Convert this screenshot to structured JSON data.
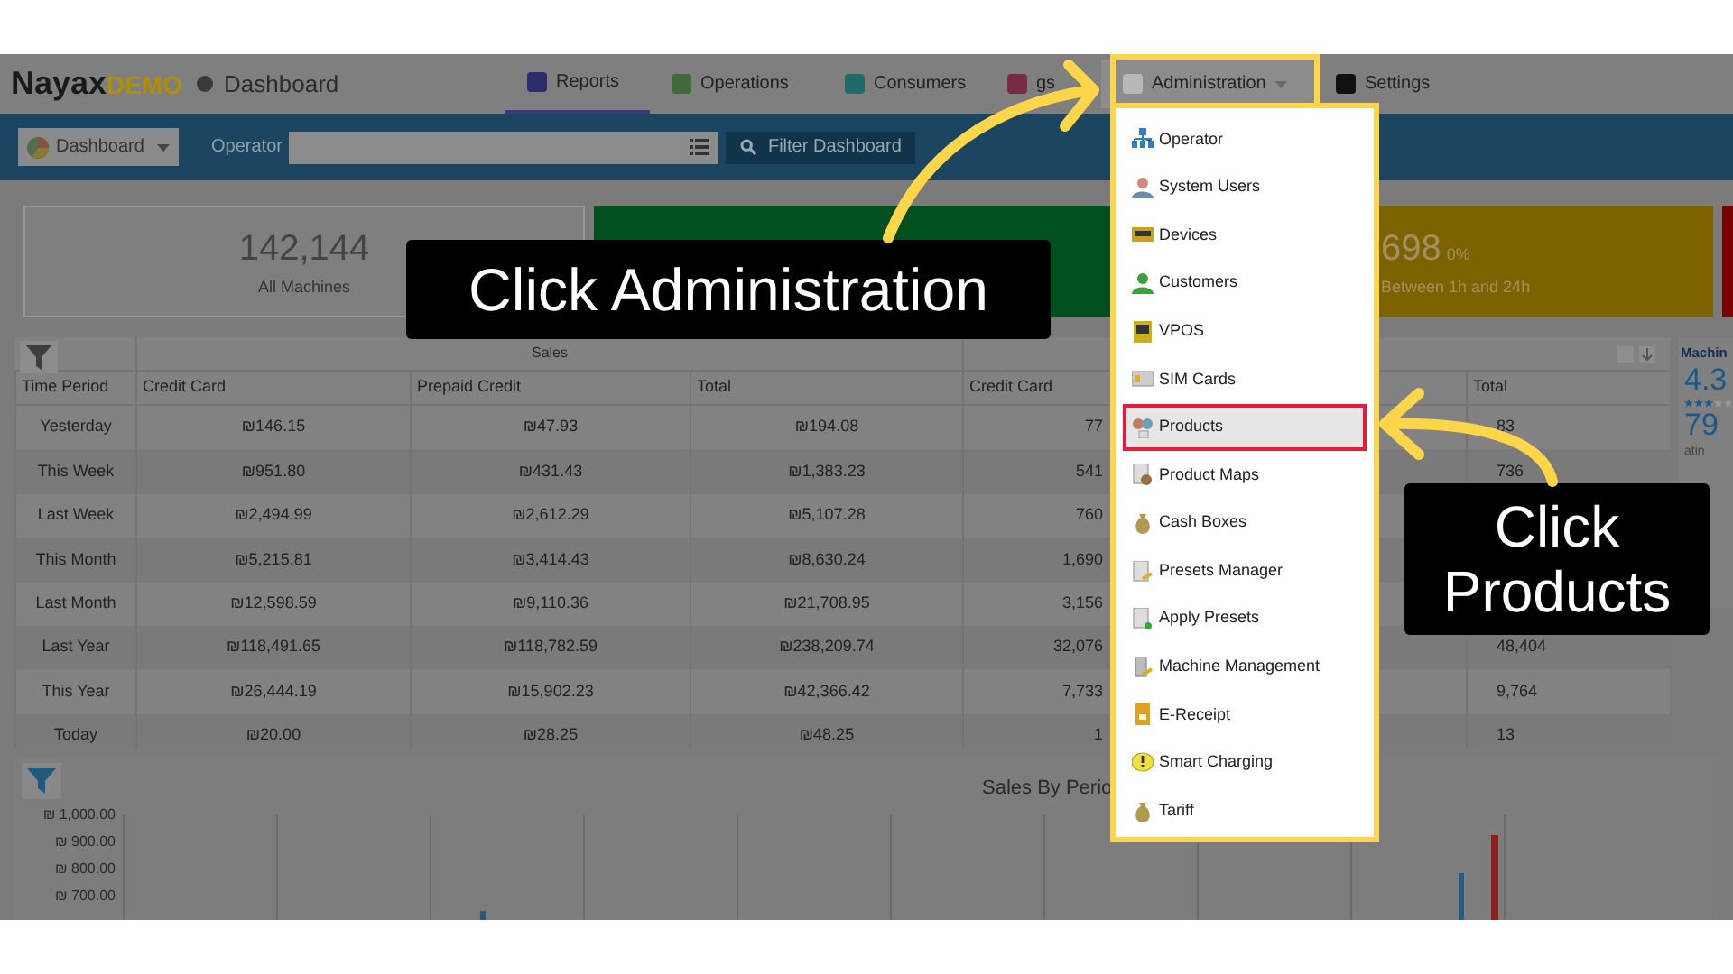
{
  "header": {
    "logo": "Nayax",
    "logo_suffix": "DEMO",
    "page_title": "Dashboard"
  },
  "nav_tabs": [
    {
      "label": "Reports",
      "selected": true
    },
    {
      "label": "Operations",
      "selected": false
    },
    {
      "label": "Consumers",
      "selected": false
    },
    {
      "label": "gs",
      "selected": false
    },
    {
      "label": "Administration",
      "selected": false,
      "expanded": true
    },
    {
      "label": "Settings",
      "selected": false
    }
  ],
  "toolbar": {
    "dashboard_button": "Dashboard",
    "operator_label": "Operator",
    "filter_button": "Filter Dashboard"
  },
  "stat_cards": [
    {
      "value": "142,144",
      "caption": "All Machines",
      "color": "#7f7f7f"
    },
    {
      "color": "#00501f"
    },
    {
      "value": "698",
      "percent": "0%",
      "caption": "Between 1h and 24h",
      "color": "#7d6300"
    },
    {
      "color": "#7a0000"
    }
  ],
  "sales_table": {
    "group_header": "Sales",
    "columns": [
      "Time Period",
      "Credit Card",
      "Prepaid Credit",
      "Total",
      "Credit Card",
      "Total"
    ],
    "rows": [
      {
        "cells": [
          "Yesterday",
          "₪146.15",
          "₪47.93",
          "₪194.08",
          "77",
          "83"
        ]
      },
      {
        "cells": [
          "This Week",
          "₪951.80",
          "₪431.43",
          "₪1,383.23",
          "541",
          "736"
        ]
      },
      {
        "cells": [
          "Last Week",
          "₪2,494.99",
          "₪2,612.29",
          "₪5,107.28",
          "760"
        ]
      },
      {
        "cells": [
          "This Month",
          "₪5,215.81",
          "₪3,414.43",
          "₪8,630.24",
          "1,690"
        ]
      },
      {
        "cells": [
          "Last Month",
          "₪12,598.59",
          "₪9,110.36",
          "₪21,708.95",
          "3,156"
        ]
      },
      {
        "cells": [
          "Last Year",
          "₪118,491.65",
          "₪118,782.59",
          "₪238,209.74",
          "32,076",
          "48,404"
        ]
      },
      {
        "cells": [
          "This Year",
          "₪26,444.19",
          "₪15,902.23",
          "₪42,366.42",
          "7,733",
          "9,764"
        ]
      },
      {
        "cells": [
          "Today",
          "₪20.00",
          "₪28.25",
          "₪48.25",
          "1",
          "13"
        ]
      }
    ]
  },
  "side_panel": {
    "title": "Machin",
    "rating": "4.3",
    "count": "79",
    "caption": "atin",
    "stars": 3
  },
  "chart": {
    "title": "Sales By Perio",
    "y_labels": [
      "₪ 1,000.00",
      "₪ 900.00",
      "₪ 800.00",
      "₪ 700.00"
    ]
  },
  "admin_menu": [
    {
      "label": "Operator",
      "selected": false
    },
    {
      "label": "System Users",
      "selected": false
    },
    {
      "label": "Devices",
      "selected": false
    },
    {
      "label": "Customers",
      "selected": false
    },
    {
      "label": "VPOS",
      "selected": false
    },
    {
      "label": "SIM Cards",
      "selected": false
    },
    {
      "label": "Products",
      "selected": true
    },
    {
      "label": "Product Maps",
      "selected": false
    },
    {
      "label": "Cash Boxes",
      "selected": false
    },
    {
      "label": "Presets Manager",
      "selected": false
    },
    {
      "label": "Apply Presets",
      "selected": false
    },
    {
      "label": "Machine Management",
      "selected": false
    },
    {
      "label": "E-Receipt",
      "selected": false
    },
    {
      "label": "Smart Charging",
      "selected": false
    },
    {
      "label": "Tariff",
      "selected": false
    }
  ],
  "callouts": [
    "Click Administration",
    "Click Products"
  ]
}
